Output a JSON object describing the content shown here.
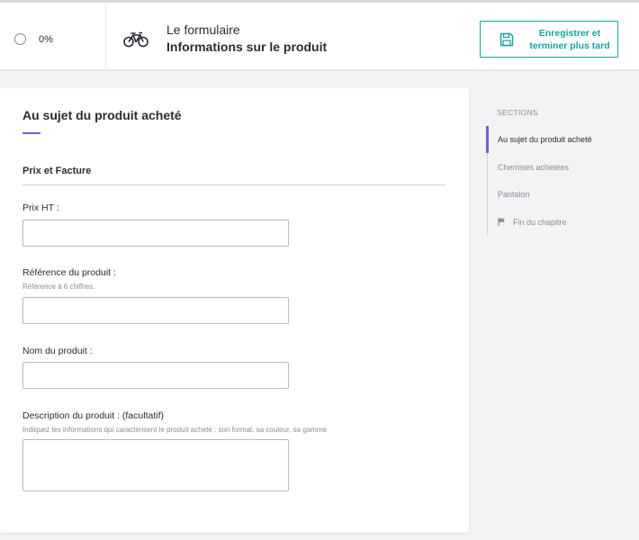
{
  "header": {
    "progress": "0%",
    "form_label": "Le formulaire",
    "form_title": "Informations sur le produit",
    "save_button": {
      "line1": "Enregistrer et",
      "line2": "terminer plus tard"
    }
  },
  "card": {
    "title": "Au sujet du produit acheté",
    "section_heading": "Prix et Facture",
    "fields": [
      {
        "label": "Prix HT :",
        "hint": "",
        "value": "",
        "placeholder": ""
      },
      {
        "label": "Référence du produit :",
        "hint": "Référence à 6 chiffres.",
        "value": "",
        "placeholder": ""
      },
      {
        "label": "Nom du produit :",
        "hint": "",
        "value": "",
        "placeholder": ""
      },
      {
        "label": "Description du produit : (facultatif)",
        "hint": "Indiquez les informations qui caractérisent le produit acheté : son format, sa couleur, sa gamme",
        "value": "",
        "placeholder": ""
      }
    ]
  },
  "sections": {
    "title": "SECTIONS",
    "items": [
      {
        "label": "Au sujet du produit acheté",
        "active": true
      },
      {
        "label": "Chemises achetées",
        "active": false
      },
      {
        "label": "Pantalon",
        "active": false
      },
      {
        "label": "Fin du chapitre",
        "active": false,
        "icon": "flag-icon"
      }
    ]
  },
  "colors": {
    "accent": "#6c63d6",
    "save_teal": "#17a2a2",
    "background": "#f3f3f5"
  }
}
